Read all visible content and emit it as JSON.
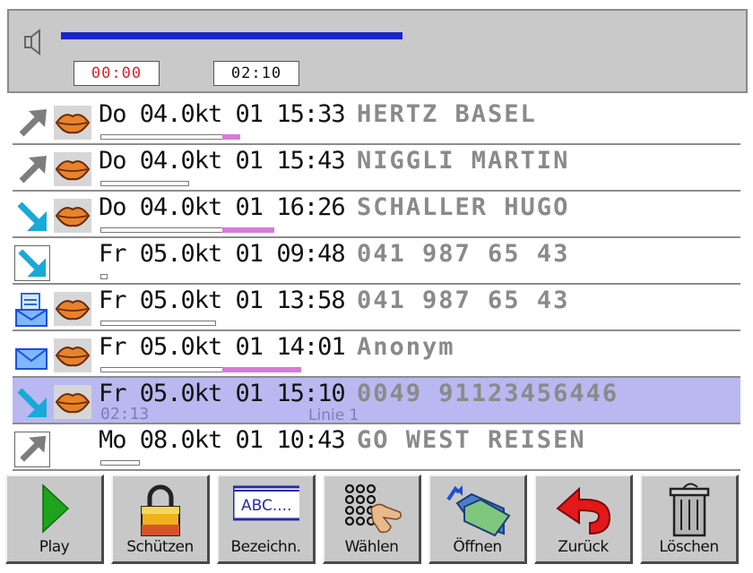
{
  "player": {
    "elapsed": "00:00",
    "total": "02:10",
    "progress_fraction": 0.68,
    "icon": "speaker-icon",
    "colors": {
      "progress": "#1a23c8",
      "elapsed": "#e0202a"
    }
  },
  "entries": [
    {
      "direction": "outgoing",
      "voice": true,
      "mail": false,
      "boxed": false,
      "text": "Do 04.0kt 01 15:33",
      "caller": "HERTZ BASEL",
      "bar": 0.46,
      "played": [
        0.4,
        0.46
      ]
    },
    {
      "direction": "outgoing",
      "voice": true,
      "mail": false,
      "boxed": false,
      "text": "Do 04.0kt 01 15:43",
      "caller": "NIGGLI MARTIN",
      "bar": 0.29,
      "played": null
    },
    {
      "direction": "incoming",
      "voice": true,
      "mail": false,
      "boxed": false,
      "text": "Do 04.0kt 01 16:26",
      "caller": "SCHALLER HUGO",
      "bar": 0.57,
      "played": [
        0.4,
        0.57
      ]
    },
    {
      "direction": "incoming",
      "voice": false,
      "mail": false,
      "boxed": true,
      "text": "Fr 05.0kt 01 09:48",
      "caller": "041 987 65 43",
      "bar": 0.02,
      "played": null
    },
    {
      "direction": "mail-document",
      "voice": true,
      "mail": true,
      "boxed": false,
      "text": "Fr 05.0kt 01 13:58",
      "caller": "041 987 65 43",
      "bar": 0.38,
      "played": null
    },
    {
      "direction": "mail",
      "voice": true,
      "mail": true,
      "boxed": false,
      "text": "Fr 05.0kt 01 14:01",
      "caller": "Anonym",
      "bar": 0.66,
      "played": [
        0.4,
        0.66
      ]
    },
    {
      "direction": "incoming",
      "voice": true,
      "mail": false,
      "boxed": false,
      "selected": true,
      "text": "Fr 05.0kt 01 15:10",
      "caller": "0049 91123456446",
      "sub_duration": "02:13",
      "sub_line": "Linie 1",
      "bar": 0,
      "played": null
    },
    {
      "direction": "outgoing",
      "voice": false,
      "mail": false,
      "boxed": true,
      "text": "Mo 08.0kt 01 10:43",
      "caller": "GO WEST REISEN",
      "bar": 0.13,
      "played": null
    }
  ],
  "toolbar": {
    "play": "Play",
    "protect": "Schützen",
    "label_btn": "Bezeichn.",
    "label_icon_text": "ABC....",
    "dial": "Wählen",
    "open": "Öffnen",
    "back": "Zurück",
    "delete": "Löschen"
  },
  "colors": {
    "selected_row": "#b9b8f0",
    "played_segment": "#d77ad9",
    "incoming_arrow": "#19a9d9",
    "outgoing_arrow": "#7d7d7d"
  }
}
